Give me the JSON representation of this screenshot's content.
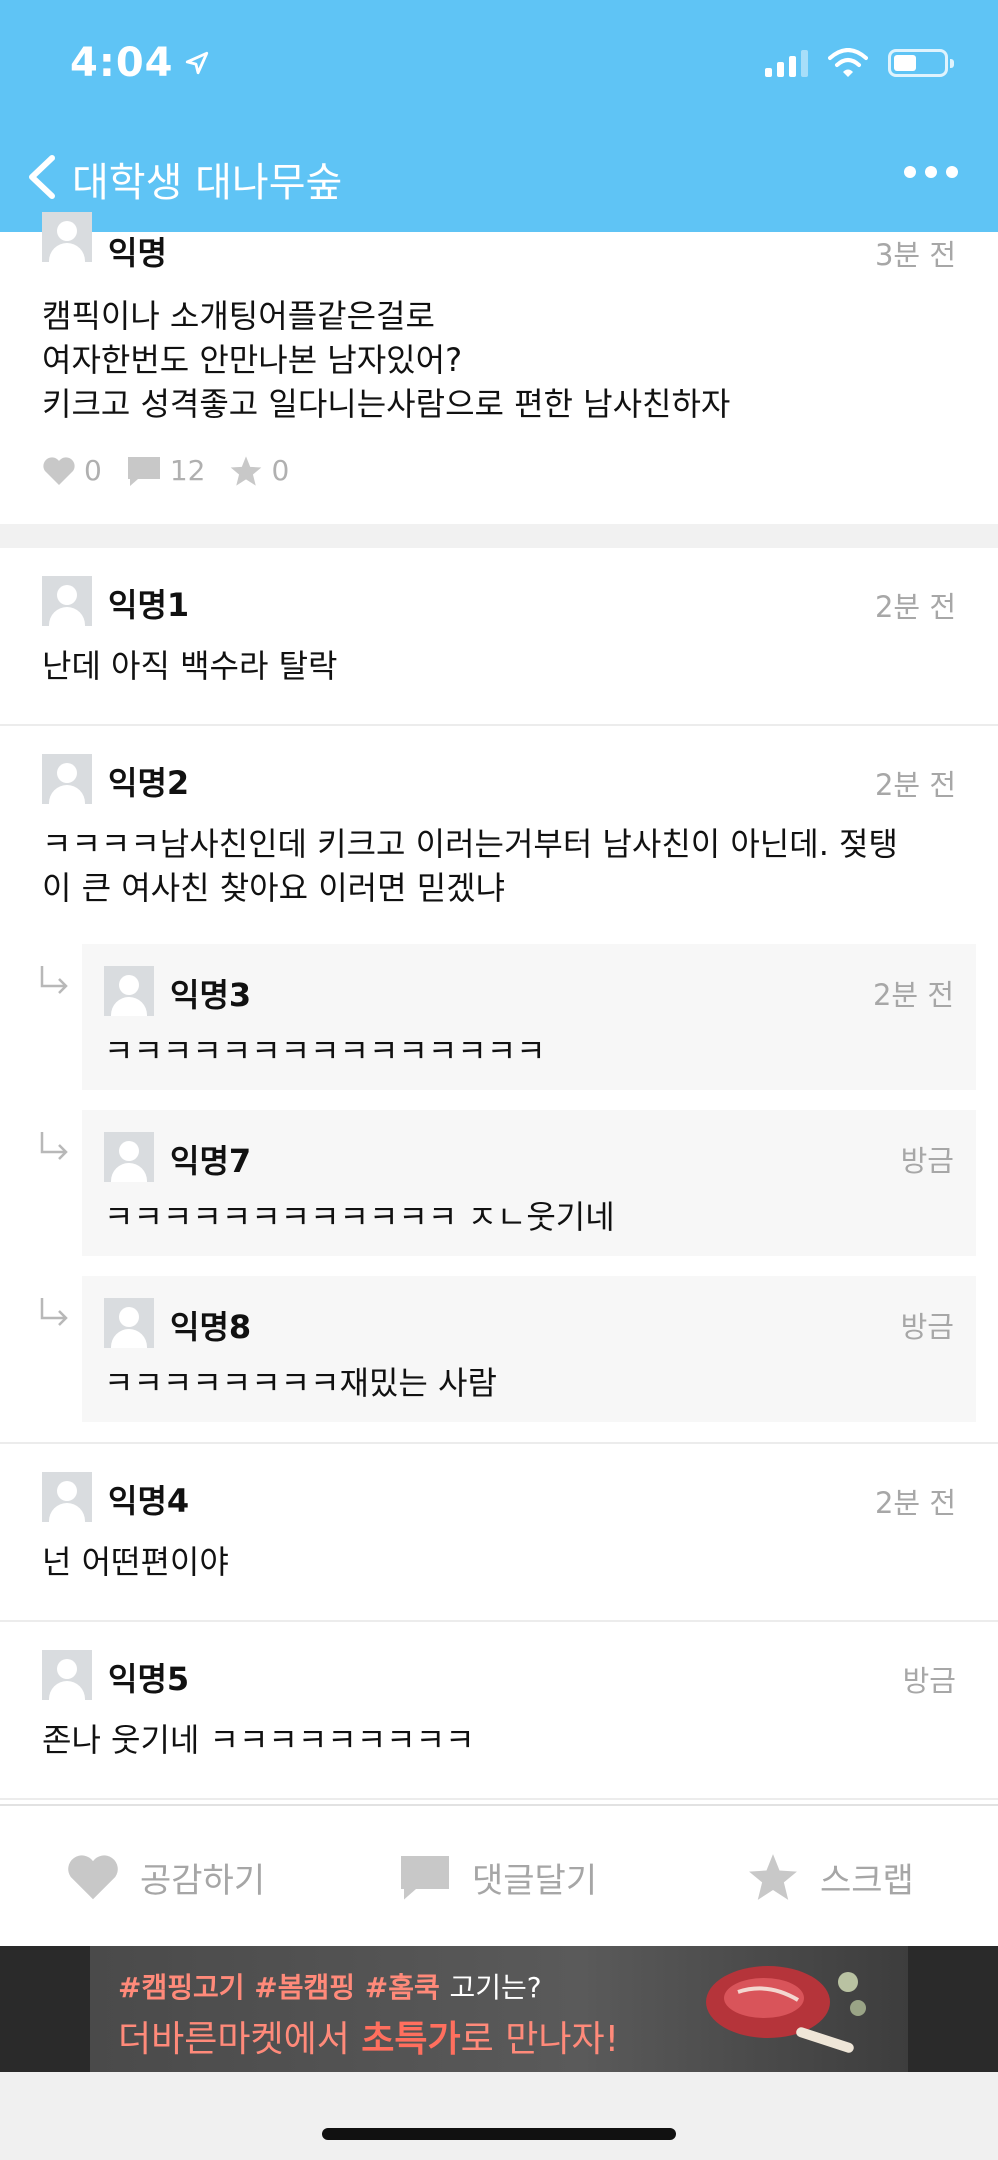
{
  "status_bar": {
    "time": "4:04"
  },
  "nav": {
    "title": "대학생 대나무숲"
  },
  "post": {
    "author": "익명",
    "time": "3분 전",
    "lines": [
      "캠픽이나 소개팅어플같은걸로",
      "여자한번도 안만나본 남자있어?",
      "키크고 성격좋고 일다니는사람으로 편한 남사친하자"
    ],
    "likes": "0",
    "comments": "12",
    "scraps": "0"
  },
  "comments": [
    {
      "author": "익명1",
      "time": "2분 전",
      "text": "난데 아직 백수라 탈락"
    },
    {
      "author": "익명2",
      "time": "2분 전",
      "text_line1": "ㅋㅋㅋㅋ남사친인데 키크고 이러는거부터 남사친이 아닌데. 젖탱",
      "text_line2": "이 큰 여사친 찾아요 이러면 믿겠냐"
    },
    {
      "author": "익명4",
      "time": "2분 전",
      "text": "넌 어떤편이야"
    },
    {
      "author": "익명5",
      "time": "방금",
      "text": "존나 웃기네 ㅋㅋㅋㅋㅋㅋㅋㅋㅋ"
    }
  ],
  "replies": [
    {
      "author": "익명3",
      "time": "2분 전",
      "text": "ㅋㅋㅋㅋㅋㅋㅋㅋㅋㅋㅋㅋㅋㅋㅋ"
    },
    {
      "author": "익명7",
      "time": "방금",
      "text": "ㅋㅋㅋㅋㅋㅋㅋㅋㅋㅋㅋㅋ ㅈㄴ웃기네"
    },
    {
      "author": "익명8",
      "time": "방금",
      "text": "ㅋㅋㅋㅋㅋㅋㅋㅋ재밌는 사람"
    }
  ],
  "actions": {
    "like": "공감하기",
    "comment": "댓글달기",
    "scrap": "스크랩"
  },
  "ad": {
    "tag1": "#캠핑고기",
    "tag2": "#봄캠핑",
    "tag3": "#홈쿡",
    "tail": "고기는?",
    "line2_a": "더바른마켓에서 ",
    "line2_b": "초특가",
    "line2_c": "로 만나자!"
  },
  "colors": {
    "header_bg": "#5fc4f5",
    "meta_gray": "#a7a7a7",
    "reply_bg": "#f7f7f7"
  }
}
